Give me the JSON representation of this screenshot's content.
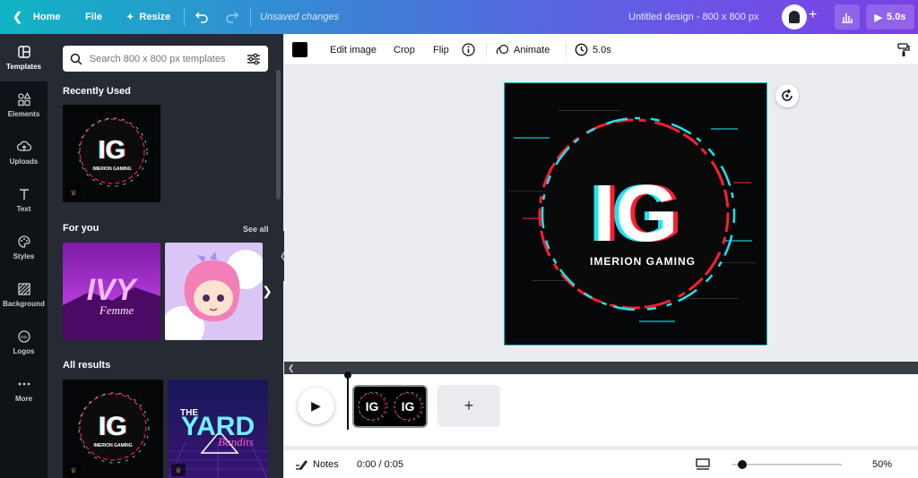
{
  "topbar": {
    "home_label": "Home",
    "file_label": "File",
    "resize_label": "Resize",
    "save_status": "Unsaved changes",
    "design_title": "Untitled design - 800 x 800 px",
    "play_duration": "5.0s"
  },
  "rail": {
    "items": [
      {
        "label": "Templates",
        "icon": "templates-icon"
      },
      {
        "label": "Elements",
        "icon": "elements-icon"
      },
      {
        "label": "Uploads",
        "icon": "upload-icon"
      },
      {
        "label": "Text",
        "icon": "text-icon"
      },
      {
        "label": "Styles",
        "icon": "palette-icon"
      },
      {
        "label": "Background",
        "icon": "background-icon"
      },
      {
        "label": "Logos",
        "icon": "logos-icon"
      },
      {
        "label": "More",
        "icon": "more-icon"
      }
    ]
  },
  "panel": {
    "search_placeholder": "Search 800 x 800 px templates",
    "recently_used_title": "Recently Used",
    "for_you_title": "For you",
    "see_all_label": "See all",
    "all_results_title": "All results",
    "thumbnails": {
      "ig_big": "IG",
      "ig_sub": "IMERION GAMING",
      "ivy_line1": "IVY",
      "ivy_line2": "Femme",
      "yard_the": "THE",
      "yard_main": "YARD",
      "yard_sub": "Bandits"
    }
  },
  "toolbar": {
    "color_value": "#000000",
    "edit_image_label": "Edit image",
    "crop_label": "Crop",
    "flip_label": "Flip",
    "animate_label": "Animate",
    "duration_label": "5.0s"
  },
  "canvas": {
    "logo_letters": "IG",
    "logo_subtitle": "IMERION GAMING"
  },
  "timeline": {
    "page_thumb_a": "IG",
    "page_thumb_b": "IG",
    "add_page_symbol": "+"
  },
  "footer": {
    "notes_label": "Notes",
    "time_display": "0:00 / 0:05",
    "zoom_label": "50%",
    "zoom_fraction": 0.05
  },
  "colors": {
    "accent_cyan": "#00c4cc",
    "glitch_red": "#ff1e2d",
    "glitch_cyan": "#1fe3f0",
    "panel_bg": "#252a33",
    "rail_bg": "#0e1318"
  }
}
